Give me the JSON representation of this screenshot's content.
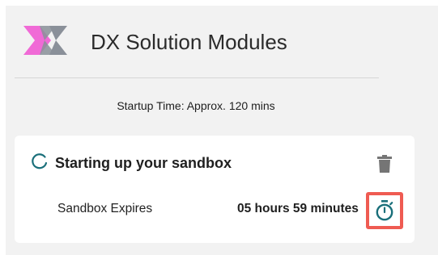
{
  "header": {
    "app_title": "DX Solution Modules",
    "logo_icon": "dx-logo-icon"
  },
  "startup": {
    "text": "Startup Time: Approx. 120 mins"
  },
  "sandbox_card": {
    "status_text": "Starting up your sandbox",
    "status_icon": "loading-spinner-icon",
    "delete_icon": "trash-icon",
    "expires_label": "Sandbox Expires",
    "expires_value": "05 hours 59 minutes",
    "timer_icon": "stopwatch-icon"
  },
  "colors": {
    "accent_teal": "#1a6f7a",
    "logo_pink": "#f06ad6",
    "logo_gray": "#8a9099",
    "highlight_red": "#ef5b52",
    "trash_gray": "#757575"
  }
}
